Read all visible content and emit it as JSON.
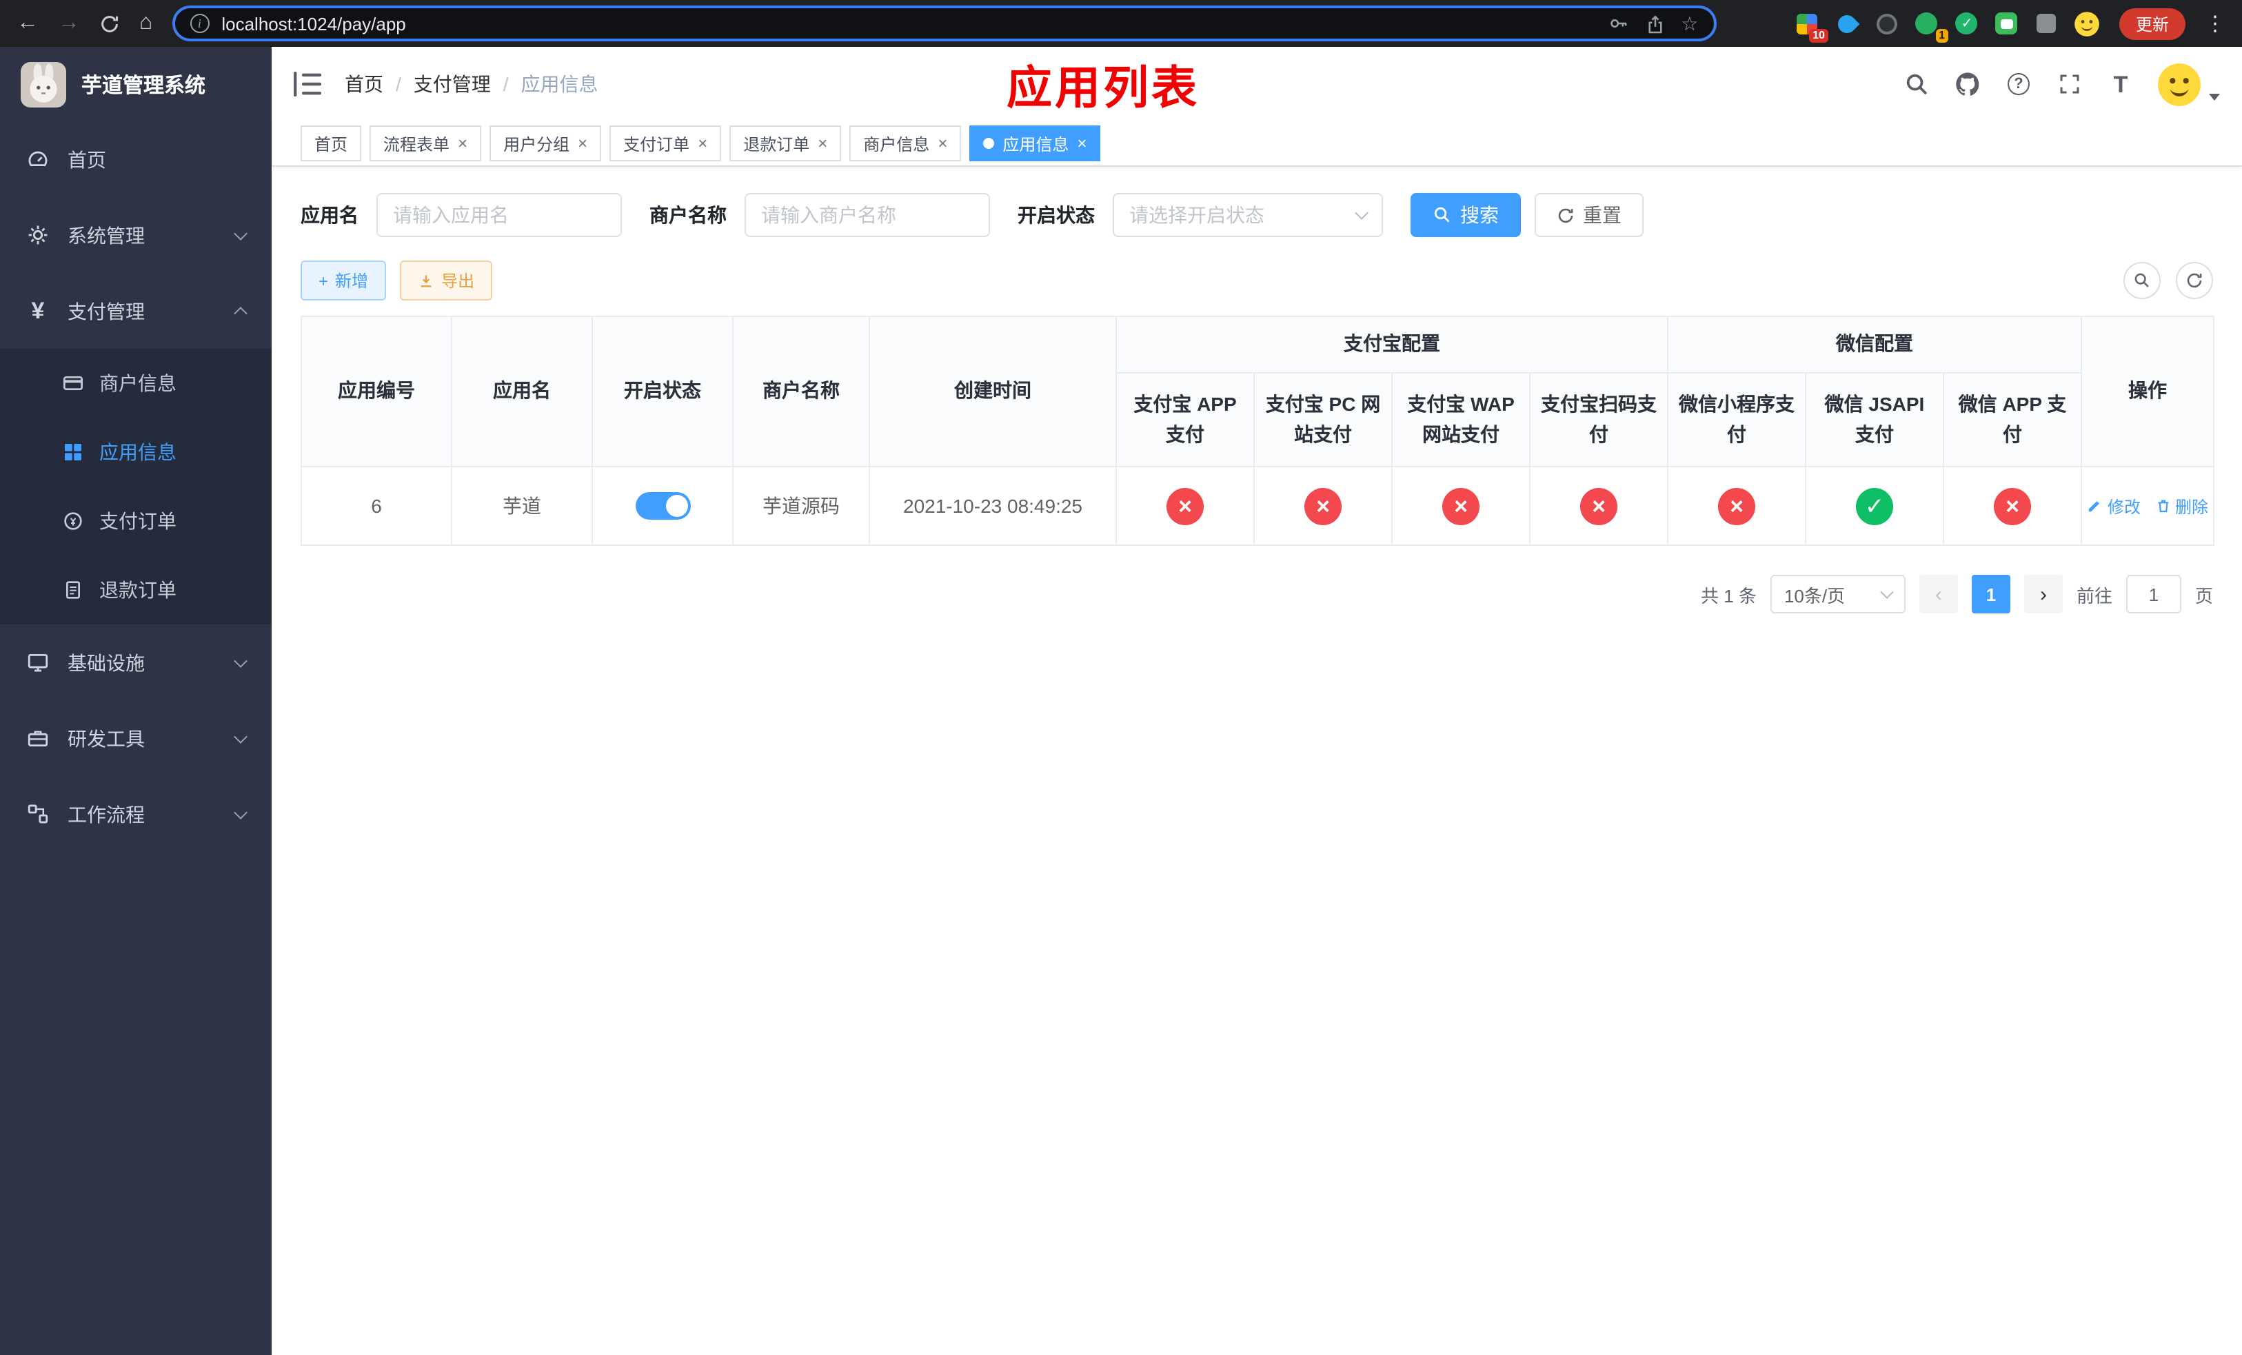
{
  "browser": {
    "url": "localhost:1024/pay/app",
    "update_label": "更新",
    "ext_badge_count": "10",
    "avatar_badge_count": "1"
  },
  "sidebar": {
    "title": "芋道管理系统",
    "items": [
      {
        "label": "首页"
      },
      {
        "label": "系统管理"
      },
      {
        "label": "支付管理",
        "children": [
          {
            "label": "商户信息"
          },
          {
            "label": "应用信息"
          },
          {
            "label": "支付订单"
          },
          {
            "label": "退款订单"
          }
        ]
      },
      {
        "label": "基础设施"
      },
      {
        "label": "研发工具"
      },
      {
        "label": "工作流程"
      }
    ]
  },
  "header": {
    "breadcrumb": [
      "首页",
      "支付管理",
      "应用信息"
    ],
    "overlay_title": "应用列表",
    "overlay_color": "#f20000"
  },
  "tabs": [
    {
      "label": "首页"
    },
    {
      "label": "流程表单"
    },
    {
      "label": "用户分组"
    },
    {
      "label": "支付订单"
    },
    {
      "label": "退款订单"
    },
    {
      "label": "商户信息"
    },
    {
      "label": "应用信息"
    }
  ],
  "filters": {
    "app_name_label": "应用名",
    "app_name_placeholder": "请输入应用名",
    "merchant_label": "商户名称",
    "merchant_placeholder": "请输入商户名称",
    "status_label": "开启状态",
    "status_placeholder": "请选择开启状态",
    "search_label": "搜索",
    "reset_label": "重置"
  },
  "toolbar": {
    "add_label": "新增",
    "export_label": "导出"
  },
  "table": {
    "cols": [
      "应用编号",
      "应用名",
      "开启状态",
      "商户名称",
      "创建时间"
    ],
    "groups": [
      {
        "label": "支付宝配置",
        "cols": [
          "支付宝 APP 支付",
          "支付宝 PC 网站支付",
          "支付宝 WAP 网站支付",
          "支付宝扫码支付"
        ]
      },
      {
        "label": "微信配置",
        "cols": [
          "微信小程序支付",
          "微信 JSAPI 支付",
          "微信 APP 支付"
        ]
      }
    ],
    "ops_label": "操作",
    "row": {
      "id": "6",
      "name": "芋道",
      "enabled": true,
      "merchant": "芋道源码",
      "created": "2021-10-23 08:49:25",
      "configs": [
        "no",
        "no",
        "no",
        "no",
        "no",
        "yes",
        "no"
      ],
      "edit_label": "修改",
      "delete_label": "删除"
    },
    "status_colors": {
      "yes": "#0fbf66",
      "no": "#f3494e"
    },
    "status_glyphs": {
      "yes": "✓",
      "no": "×"
    }
  },
  "pagination": {
    "total": "共 1 条",
    "page_size": "10条/页",
    "current_page": "1",
    "goto_prefix": "前往",
    "goto_value": "1",
    "goto_suffix": "页"
  }
}
